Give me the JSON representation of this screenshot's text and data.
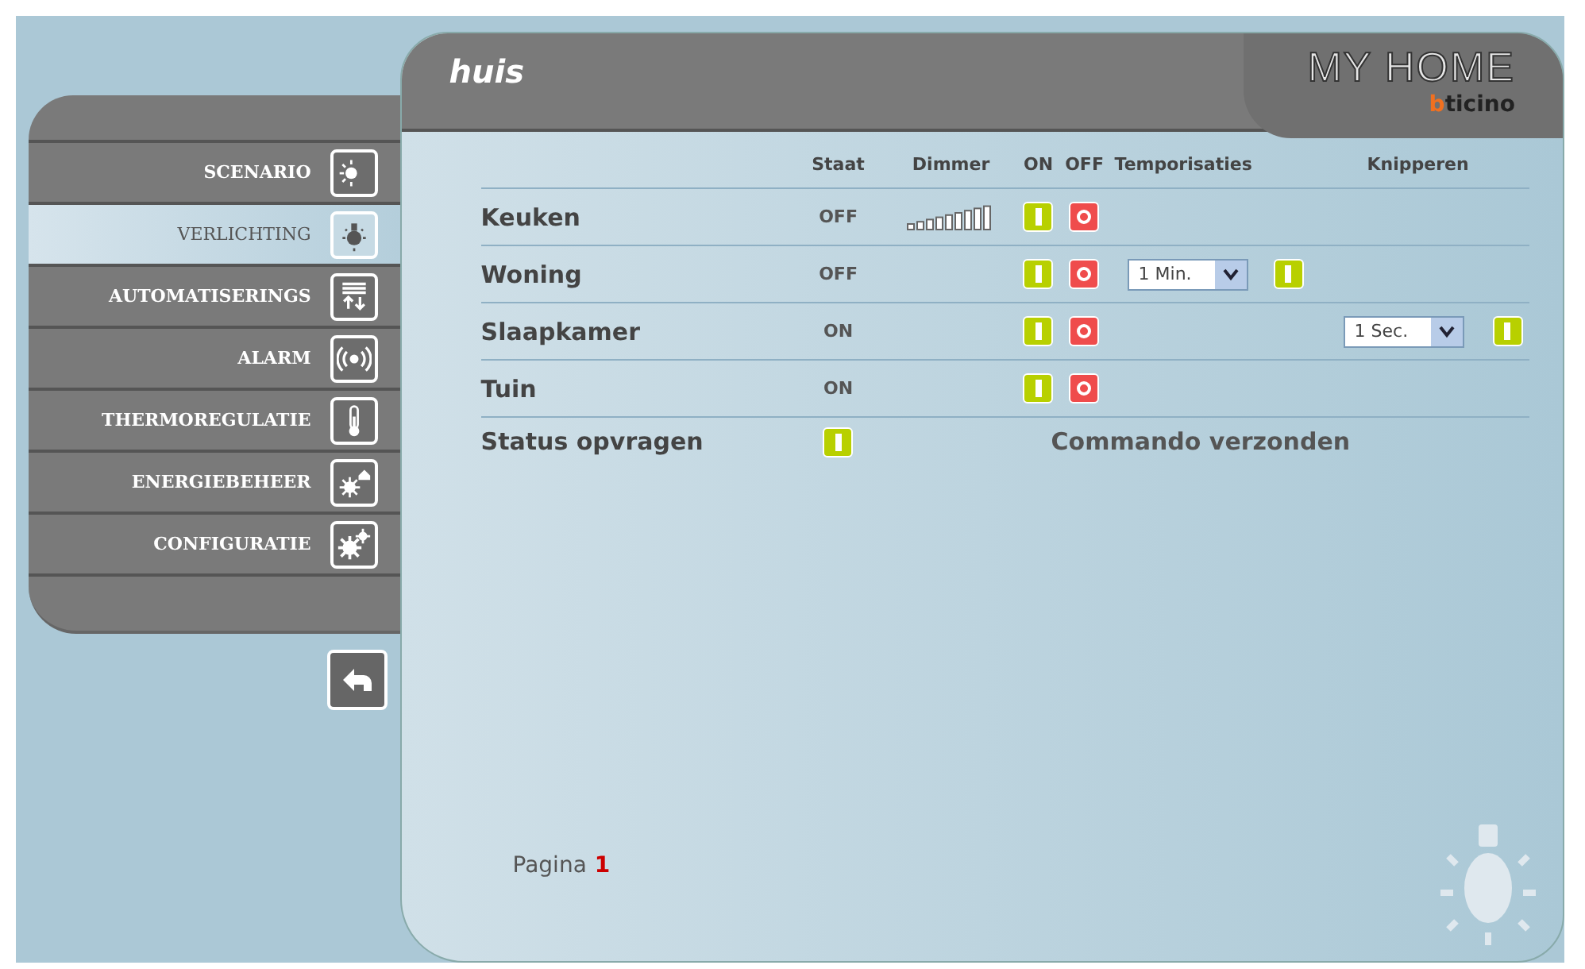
{
  "title": "huis",
  "logo": {
    "name": "MY HOME",
    "brand": "bticino"
  },
  "menu": [
    {
      "label": "SCENARIO",
      "selected": false
    },
    {
      "label": "VERLICHTING",
      "selected": true
    },
    {
      "label": "AUTOMATISERINGS",
      "selected": false
    },
    {
      "label": "ALARM",
      "selected": false
    },
    {
      "label": "THERMOREGULATIE",
      "selected": false
    },
    {
      "label": "ENERGIEBEHEER",
      "selected": false
    },
    {
      "label": "CONFIGURATIE",
      "selected": false
    }
  ],
  "columns": [
    "Staat",
    "Dimmer",
    "ON",
    "OFF",
    "Temporisaties",
    "Knipperen"
  ],
  "rows": [
    {
      "name": "Keuken",
      "state": "OFF",
      "dimmer": true
    },
    {
      "name": "Woning",
      "state": "OFF",
      "dimmer": false,
      "timer": "1 Min."
    },
    {
      "name": "Slaapkamer",
      "state": "ON",
      "dimmer": false,
      "blink": "1 Sec."
    },
    {
      "name": "Tuin",
      "state": "ON",
      "dimmer": false
    }
  ],
  "status": {
    "label": "Status opvragen",
    "message": "Commando verzonden"
  },
  "pager": {
    "label": "Pagina",
    "current": "1"
  }
}
